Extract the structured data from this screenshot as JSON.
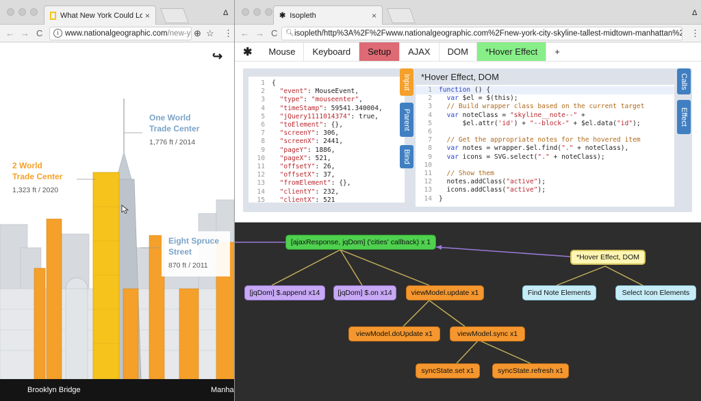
{
  "left_browser": {
    "tab_title": "What New York Could Look Lik",
    "url_host": "www.nationalgeographic.com",
    "url_path": "/new-yo...",
    "nav": {
      "back": "←",
      "forward": "→",
      "reload": "C"
    },
    "zoom_icon": "⊕",
    "star_icon": "☆",
    "menu_icon": "⋮",
    "profile_icon": "Δ",
    "close_tab": "×",
    "share_icon": "↪"
  },
  "skyline": {
    "labels": [
      {
        "title": "One World Trade Center",
        "title_l1": "One World",
        "title_l2": "Trade Center",
        "sub": "1,776 ft / 2014"
      },
      {
        "title": "2 World Trade Center",
        "title_l1": "2 World",
        "title_l2": "Trade Center",
        "sub": "1,323 ft / 2020"
      },
      {
        "title": "Eight Spruce Street",
        "title_l1": "Eight Spruce",
        "title_l2": "Street",
        "sub": "870 ft / 2011"
      }
    ],
    "footer_left": "Brooklyn Bridge",
    "footer_right": "Manha",
    "colors": {
      "highlight": "#f6c21c",
      "accent_orange": "#f5a02a",
      "label_blue": "#7aa3c7"
    }
  },
  "right_browser": {
    "tab_title": "Isopleth",
    "url": "isopleth/http%3A%2F%2Fwww.nationalgeographic.com%2Fnew-york-city-skyline-tallest-midtown-manhattan%2F",
    "close_tab": "×",
    "profile_icon": "Δ",
    "toolbar": [
      "Mouse",
      "Keyboard",
      "Setup",
      "AJAX",
      "DOM",
      "*Hover Effect",
      "+"
    ],
    "toolbar_colors": {
      "Setup": "#dd6a74",
      "*Hover Effect": "#88ee88"
    }
  },
  "inspector": {
    "side_tabs_left": [
      "Input",
      "Parent",
      "Bind"
    ],
    "side_tabs_right": [
      "Calls",
      "Effect"
    ],
    "editor_title": "*Hover Effect, DOM",
    "event_lines": [
      "{",
      "  \"event\": MouseEvent,",
      "  \"type\": \"mouseenter\",",
      "  \"timeStamp\": 59541.340004,",
      "  \"jQuery1111014374\": true,",
      "  \"toElement\": {},",
      "  \"screenY\": 306,",
      "  \"screenX\": 2441,",
      "  \"pageY\": 1886,",
      "  \"pageX\": 521,",
      "  \"offsetY\": 26,",
      "  \"offsetX\": 37,",
      "  \"fromElement\": {},",
      "  \"clientY\": 232,",
      "  \"clientX\": 521"
    ],
    "code_lines": [
      "function () {",
      "  var $el = $(this);",
      "  // Build wrapper class based on the current target",
      "  var noteClass = \"skyline__note--\" +",
      "      $el.attr('id') + \"--block-\" + $el.data(\"id\");",
      "",
      "  // Get the appropriate notes for the hovered item",
      "  var notes = wrapper.$el.find(\".\" + noteClass),",
      "  var icons = SVG.select(\".\" + noteClass);",
      "",
      "  // Show them",
      "  notes.addClass(\"active\");",
      "  icons.addClass(\"active\");",
      "}"
    ]
  },
  "graph": {
    "nodes": {
      "root": "[ajaxResponse, jqDom] ('cities' callback) x 1",
      "append": "[jqDom] $.append x14",
      "on": "[jqDom] $.on x14",
      "update": "viewModel.update x1",
      "doUpdate": "viewModel.doUpdate x1",
      "sync": "viewModel.sync x1",
      "set": "syncState.set x1",
      "refresh": "syncState.refresh x1",
      "hover": "*Hover Effect, DOM",
      "find": "Find Note Elements",
      "select": "Select Icon Elements"
    }
  }
}
